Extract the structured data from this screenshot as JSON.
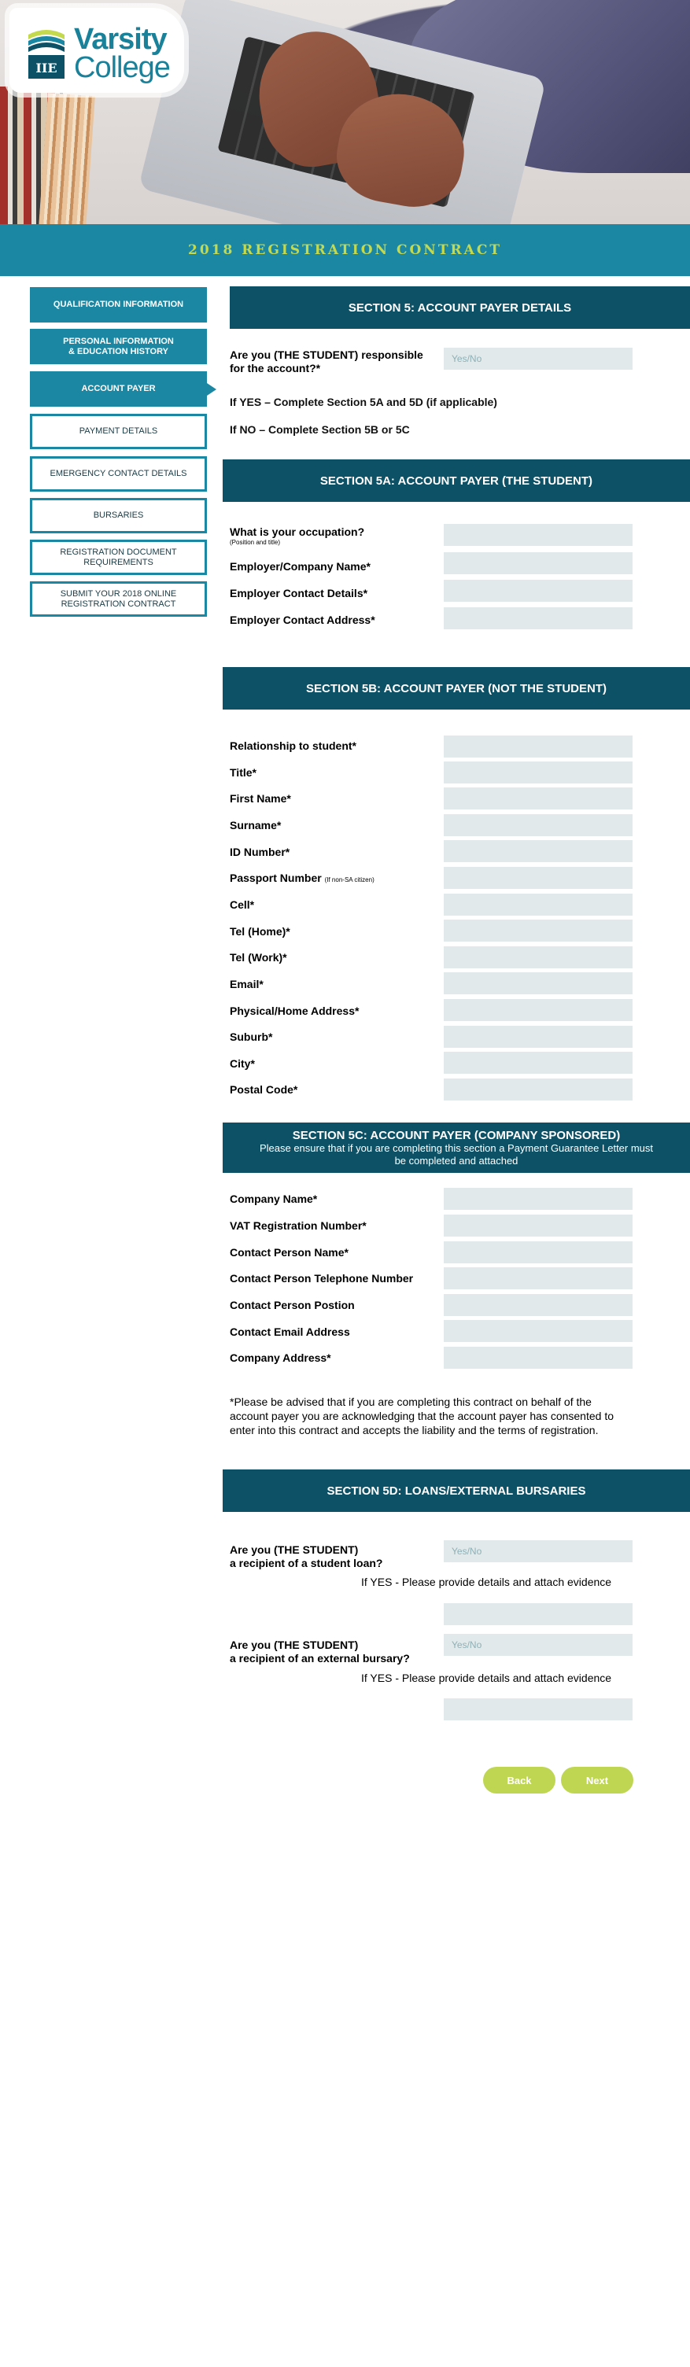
{
  "brand": {
    "name_line1": "Varsity",
    "name_line2": "College",
    "mark_text": "IIE"
  },
  "title": "2018 REGISTRATION CONTRACT",
  "sidebar": {
    "items": [
      {
        "label": "QUALIFICATION INFORMATION"
      },
      {
        "label": "PERSONAL INFORMATION & EDUCATION HISTORY"
      },
      {
        "label": "ACCOUNT PAYER"
      },
      {
        "label": "PAYMENT DETAILS"
      },
      {
        "label": "EMERGENCY CONTACT DETAILS"
      },
      {
        "label": "BURSARIES"
      },
      {
        "label": "REGISTRATION DOCUMENT REQUIREMENTS"
      },
      {
        "label": "SUBMIT YOUR 2018 ONLINE REGISTRATION CONTRACT"
      }
    ],
    "active_index": 2
  },
  "section5": {
    "header": "SECTION 5: ACCOUNT PAYER DETAILS",
    "question": "Are you (THE STUDENT) responsible for the account?*",
    "placeholder": "Yes/No",
    "if_yes": "If YES – Complete Section 5A and 5D (if applicable)",
    "if_no": "If NO – Complete Section 5B or 5C"
  },
  "section5a": {
    "header": "SECTION 5A: ACCOUNT PAYER (THE STUDENT)",
    "occupation_label": "What is your occupation?",
    "occupation_hint": "(Position and title)",
    "employer_label": "Employer/Company Name*",
    "contact_details_label": "Employer Contact Details*",
    "contact_address_label": "Employer Contact Address*"
  },
  "section5b": {
    "header": "SECTION 5B: ACCOUNT PAYER (NOT THE STUDENT)",
    "fields": [
      "Relationship to student*",
      "Title*",
      "First Name*",
      "Surname*",
      "ID Number*",
      "Passport Number",
      "Cell*",
      "Tel (Home)*",
      "Tel (Work)*",
      "Email*",
      "Physical/Home Address*",
      "Suburb*",
      "City*",
      "Postal Code*"
    ],
    "passport_hint": "(If non-SA citizen)"
  },
  "section5c": {
    "header": "SECTION 5C: ACCOUNT PAYER (COMPANY SPONSORED)",
    "subheader": "Please ensure that if you are completing this section a Payment Guarantee Letter must be completed and attached",
    "fields": [
      "Company Name*",
      "VAT Registration Number*",
      "Contact Person Name*",
      "Contact Person Telephone Number",
      "Contact Person Postion",
      "Contact Email Address",
      "Company Address*"
    ],
    "disclaimer": "*Please be advised that if you are completing this contract on behalf of the account payer you are acknowledging that the account payer has consented to enter into this contract and accepts the liability and the terms of registration."
  },
  "section5d": {
    "header": "SECTION 5D: LOANS/EXTERNAL BURSARIES",
    "loan_question_line1": "Are you (THE STUDENT)",
    "loan_question_line2": "a recipient of a student loan?",
    "loan_placeholder": "Yes/No",
    "loan_evidence": "If YES - Please provide details and attach evidence",
    "bursary_question_line1": "Are you (THE STUDENT)",
    "bursary_question_line2": "a recipient of an external bursary?",
    "bursary_placeholder": "Yes/No",
    "bursary_evidence": "If YES - Please provide details and attach evidence"
  },
  "buttons": {
    "back": "Back",
    "next": "Next"
  },
  "colors": {
    "teal": "#1b87a2",
    "dark_teal": "#0d5166",
    "lime": "#c4d94d",
    "button": "#bfd653",
    "field": "#e1e9ea"
  }
}
